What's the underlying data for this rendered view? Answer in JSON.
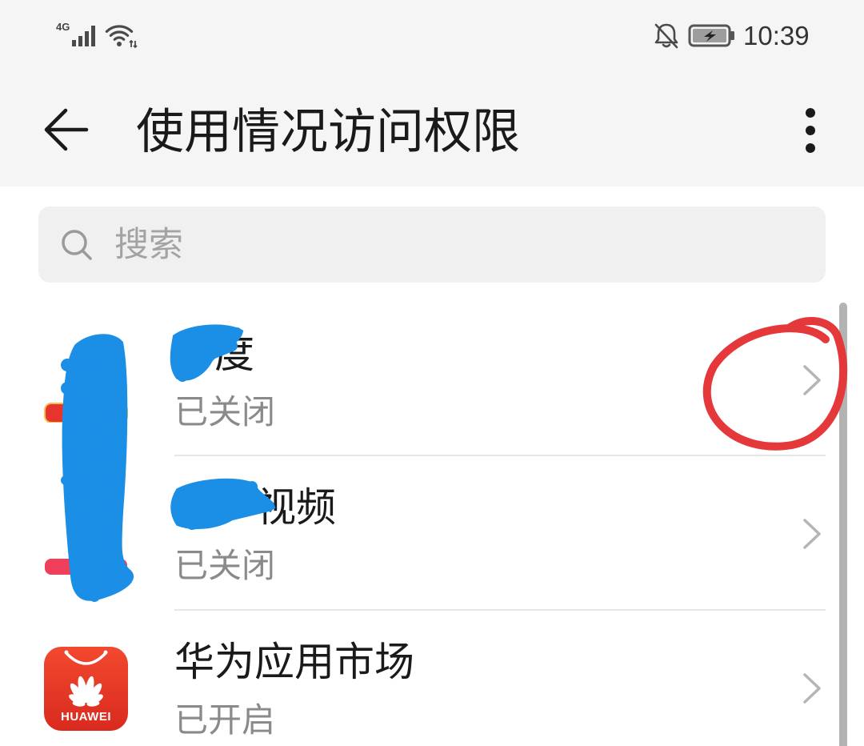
{
  "status_bar": {
    "network": "4G",
    "time": "10:39",
    "icons": [
      "signal-icon",
      "wifi-icon",
      "bell-off-icon",
      "battery-charging-icon"
    ]
  },
  "app_bar": {
    "title": "使用情况访问权限",
    "back_icon": "back-arrow-icon",
    "more_icon": "more-vertical-icon"
  },
  "search": {
    "placeholder": "搜索",
    "icon": "search-icon"
  },
  "list": {
    "items": [
      {
        "title_visible": "度",
        "status": "已关闭",
        "icon": "app-icon",
        "trailing_icon": "chevron-right-icon"
      },
      {
        "title_visible": "视频",
        "status": "已关闭",
        "icon": "app-icon",
        "trailing_icon": "chevron-right-icon"
      },
      {
        "title_visible": "华为应用市场",
        "status": "已开启",
        "icon": "huawei-appgallery-icon",
        "icon_text": "HUAWEI",
        "trailing_icon": "chevron-right-icon"
      }
    ]
  },
  "colors": {
    "header_background": "#f5f5f5",
    "search_background": "#f0f0f0",
    "brand_red": "#e8392b",
    "annotation_red": "#e5383b",
    "redaction_blue": "#1b8ee6"
  }
}
